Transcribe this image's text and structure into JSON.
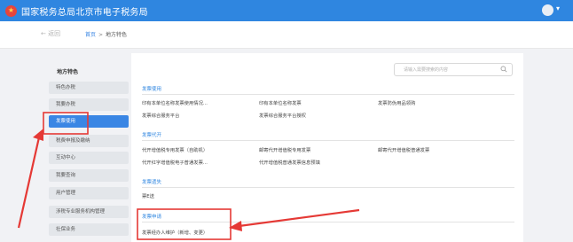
{
  "header": {
    "title": "国家税务总局北京市电子税务局",
    "brand_color": "#2f86e0"
  },
  "crumbbar": {
    "back_label": "← 返回",
    "crumbs": [
      "首页",
      "地方特色"
    ],
    "separator": ">"
  },
  "sidebar": {
    "title": "地方特色",
    "items": [
      {
        "label": "特色办税",
        "active": false
      },
      {
        "label": "我要办税",
        "active": false
      },
      {
        "label": "发票使用",
        "active": true
      },
      {
        "label": "税费申报及缴纳",
        "active": false
      },
      {
        "label": "互动中心",
        "active": false
      },
      {
        "label": "我要查询",
        "active": false
      },
      {
        "label": "用户管理",
        "active": false
      },
      {
        "label": "涉税专业服务机构管理",
        "active": false
      },
      {
        "label": "社保业务",
        "active": false
      }
    ]
  },
  "search": {
    "placeholder": "请输入需要搜索的内容"
  },
  "sections": [
    {
      "title": "发票使用",
      "links": [
        "印有本单位名称发票使用情况...",
        "印有本单位名称发票",
        "发票防伪用品领购",
        "发票综合服务平台",
        "发票综合服务平台授权"
      ]
    },
    {
      "title": "发票代开",
      "links": [
        "代开增值税专用发票（自助机）",
        "邮寄代开增值税专用发票",
        "邮寄代开增值税普通发票",
        "代开红字增值税电子普通发票...",
        "代开增值税普通发票信息预填"
      ]
    },
    {
      "title": "发票遗失",
      "links": [
        "票E送"
      ]
    },
    {
      "title": "发票申请",
      "links": [
        "发票经办人维护（新增、变更）"
      ]
    }
  ],
  "annotation_color": "#e53935"
}
